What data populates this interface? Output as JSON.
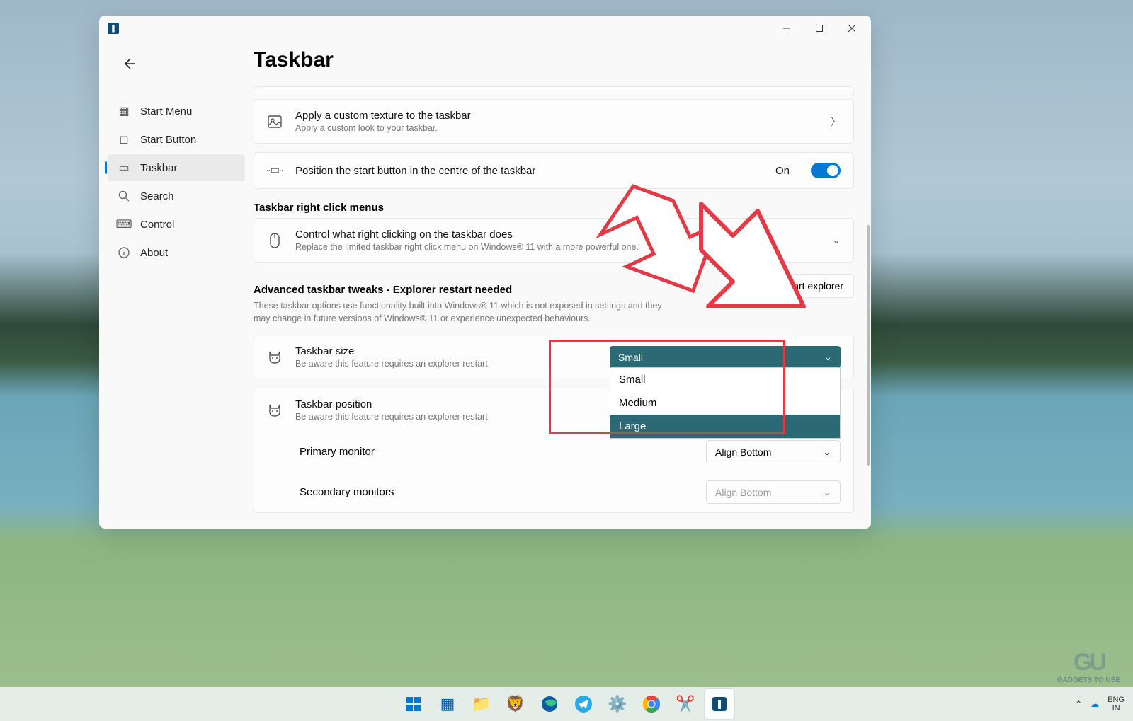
{
  "window": {
    "title": "Taskbar"
  },
  "sidebar": {
    "items": [
      {
        "label": "Start Menu",
        "icon": "grid"
      },
      {
        "label": "Start Button",
        "icon": "button"
      },
      {
        "label": "Taskbar",
        "icon": "taskbar",
        "active": true
      },
      {
        "label": "Search",
        "icon": "search"
      },
      {
        "label": "Control",
        "icon": "keyboard"
      },
      {
        "label": "About",
        "icon": "info"
      }
    ]
  },
  "settings": {
    "texture": {
      "title": "Apply a custom texture to the taskbar",
      "subtitle": "Apply a custom look to your taskbar."
    },
    "center": {
      "title": "Position the start button in the centre of the taskbar",
      "state": "On"
    },
    "rcmenu_heading": "Taskbar right click menus",
    "rcmenu": {
      "title": "Control what right clicking on the taskbar does",
      "subtitle": "Replace the limited taskbar right click menu on Windows® 11 with a more powerful one."
    },
    "advanced_heading": "Advanced taskbar tweaks - Explorer restart needed",
    "advanced_desc": "These taskbar options use functionality built into Windows® 11 which is not exposed in settings and they may change in future versions of Windows® 11 or experience unexpected behaviours.",
    "restart_btn": "Restart explorer",
    "size": {
      "title": "Taskbar size",
      "subtitle": "Be aware this feature requires an explorer restart",
      "selected": "Small",
      "options": [
        "Small",
        "Medium",
        "Large"
      ],
      "highlighted": "Large"
    },
    "position": {
      "title": "Taskbar position",
      "subtitle": "Be aware this feature requires an explorer restart"
    },
    "primary": {
      "label": "Primary monitor",
      "value": "Align Bottom"
    },
    "secondary": {
      "label": "Secondary monitors",
      "value": "Align Bottom"
    }
  },
  "systray": {
    "lang": "ENG",
    "region": "IN"
  },
  "watermark": {
    "text": "GADGETS TO USE"
  }
}
